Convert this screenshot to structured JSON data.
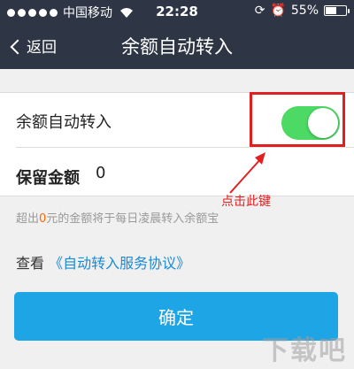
{
  "status_bar": {
    "carrier": "中国移动",
    "time": "22:28",
    "battery_percent": "55%",
    "battery_level": 0.55,
    "icons": [
      "signal-icon",
      "wifi-icon",
      "rotation-lock-icon",
      "alarm-icon",
      "battery-icon"
    ]
  },
  "nav": {
    "back_label": "返回",
    "title": "余额自动转入"
  },
  "settings": {
    "auto_transfer_label": "余额自动转入",
    "auto_transfer_enabled": true,
    "reserve_label": "保留金额",
    "reserve_value": "0"
  },
  "hint": {
    "prefix": "超出",
    "amount": "0",
    "suffix": "元的金额将于每日凌晨转入余额宝"
  },
  "agreement": {
    "prefix": "查看",
    "link_label": "《自动转入服务协议》"
  },
  "confirm_label": "确定",
  "annotation": {
    "text": "点击此键"
  },
  "watermark": "下载吧",
  "colors": {
    "nav_background": "#2e3544",
    "toggle_on": "#4cd964",
    "confirm_button": "#1ea5e6",
    "link": "#1a8ad6",
    "highlight": "#e02020"
  }
}
